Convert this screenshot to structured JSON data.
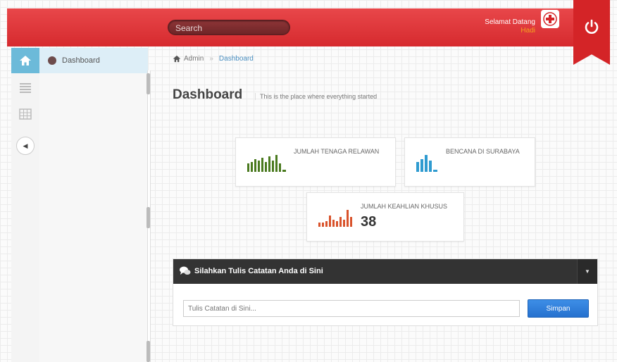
{
  "header": {
    "search_placeholder": "Search",
    "welcome_label": "Selamat Datang",
    "welcome_user": "Hadi",
    "brand_icon": "red-cross-icon",
    "power_icon": "power-icon",
    "accent": "#d62a2e"
  },
  "rail": {
    "icons": [
      "home-icon",
      "list-icon",
      "table-icon",
      "collapse-icon"
    ],
    "active_color": "#6cbad9"
  },
  "submenu": {
    "items": [
      {
        "label": "Dashboard",
        "icon": "dashboard-icon"
      }
    ]
  },
  "breadcrumb": {
    "root": "Admin",
    "current": "Dashboard"
  },
  "page": {
    "title": "Dashboard",
    "subtitle": "This is the place where everything started"
  },
  "stats": [
    {
      "label": "JUMLAH TENAGA RELAWAN",
      "value": "",
      "color": "#4a7a1f"
    },
    {
      "label": "BENCANA DI SURABAYA",
      "value": "",
      "color": "#2f9bd0"
    },
    {
      "label": "JUMLAH KEAHLIAN KHUSUS",
      "value": "38",
      "color": "#d9532c"
    }
  ],
  "notes": {
    "title": "Silahkan Tulis Catatan Anda di Sini",
    "input_placeholder": "Tulis Catatan di Sini...",
    "save_label": "Simpan",
    "button_color": "#2671cf"
  }
}
